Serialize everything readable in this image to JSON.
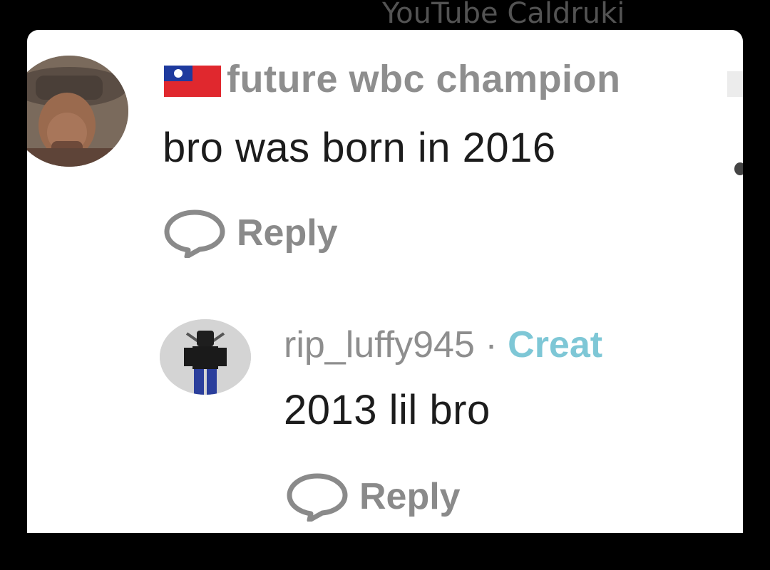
{
  "watermark": "YouTube Caldruki",
  "comment": {
    "flag_icon": "taiwan-flag-icon",
    "username": "future wbc champion",
    "text": "bro was born in 2016",
    "reply_label": "Reply"
  },
  "reply": {
    "username": "rip_luffy945",
    "separator": "·",
    "badge": "Creat",
    "text": "2013 lil bro",
    "reply_label": "Reply"
  },
  "colors": {
    "background": "#000000",
    "card": "#ffffff",
    "username": "#8e8e8e",
    "text": "#1c1c1c",
    "creator_badge": "#7ec7d6"
  }
}
